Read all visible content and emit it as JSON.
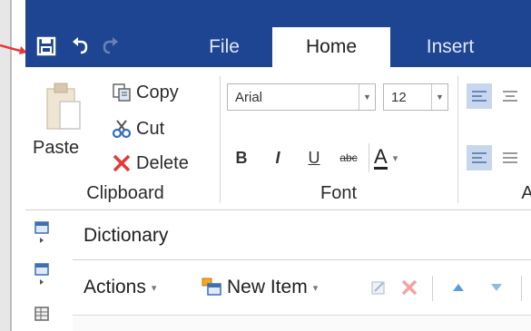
{
  "quick_access": {
    "save_icon": "save-icon",
    "undo_icon": "undo-icon",
    "redo_icon": "redo-icon"
  },
  "tabs": [
    {
      "label": "File",
      "active": false
    },
    {
      "label": "Home",
      "active": true
    },
    {
      "label": "Insert",
      "active": false
    }
  ],
  "clipboard": {
    "paste_label": "Paste",
    "copy_label": "Copy",
    "cut_label": "Cut",
    "delete_label": "Delete",
    "group_label": "Clipboard"
  },
  "font": {
    "family_value": "Arial",
    "size_value": "12",
    "bold_label": "B",
    "italic_label": "I",
    "underline_label": "U",
    "strike_label": "abc",
    "color_label": "A",
    "group_label": "Font"
  },
  "paragraph": {
    "group_label": "A"
  },
  "panel": {
    "title": "Dictionary",
    "actions_label": "Actions",
    "new_item_label": "New Item"
  },
  "colors": {
    "ribbon_blue": "#1e4592",
    "accent_red": "#e53935"
  }
}
